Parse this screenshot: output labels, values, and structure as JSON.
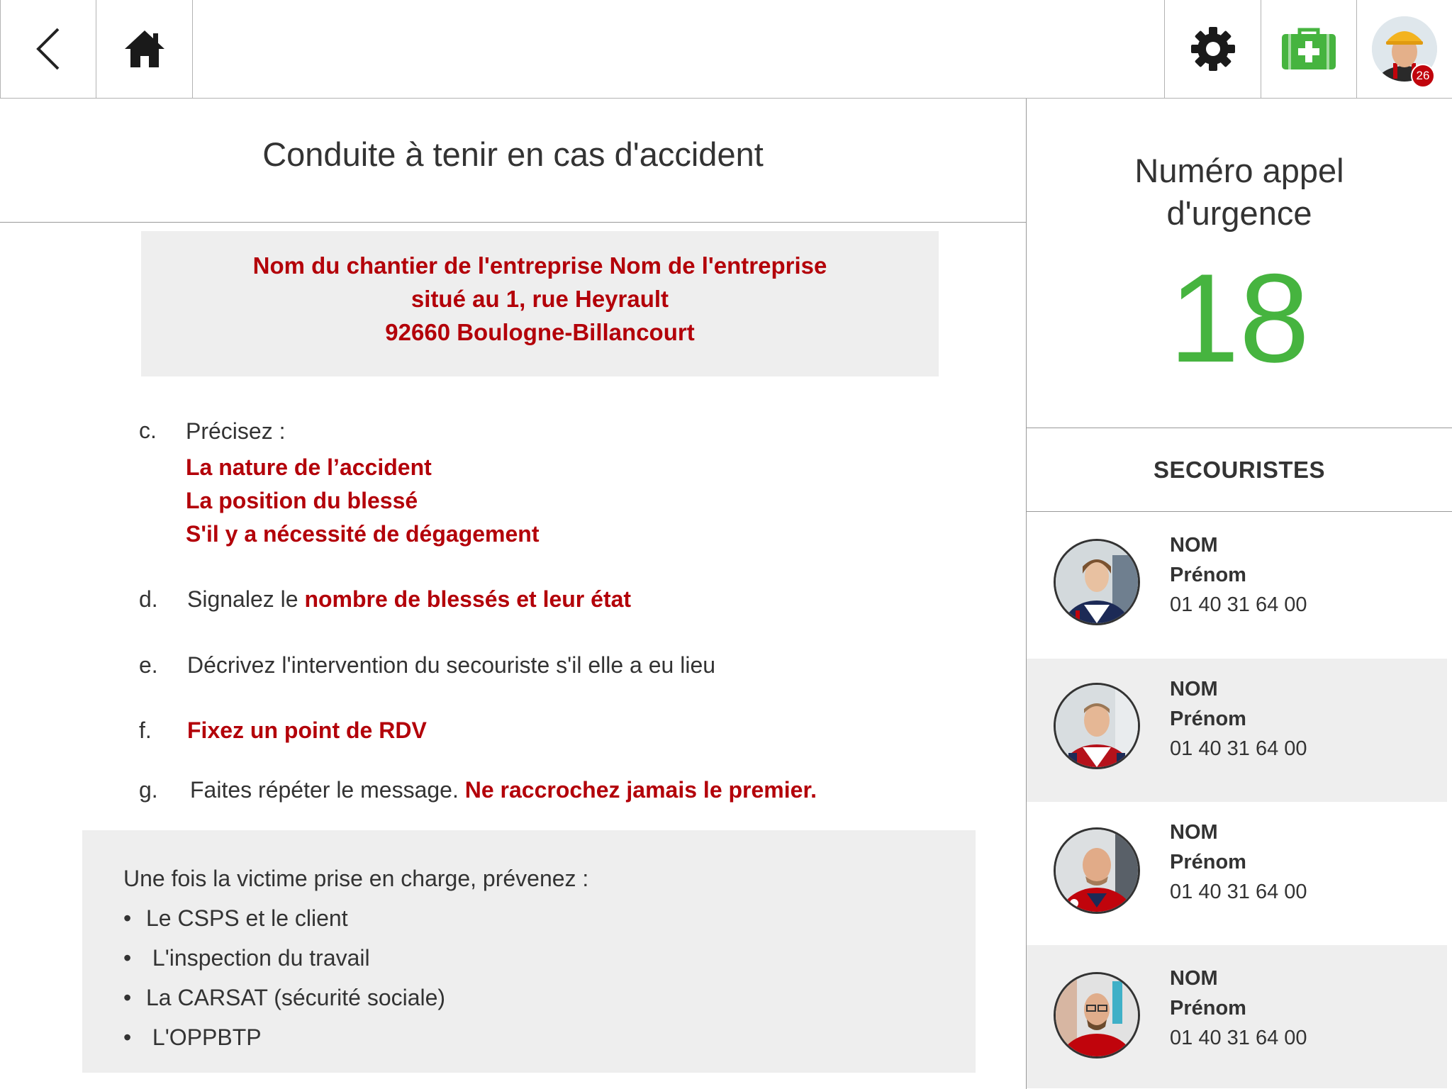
{
  "topbar": {
    "back_icon": "chevron-left-icon",
    "home_icon": "home-icon",
    "settings_icon": "gear-icon",
    "medkit_icon": "first-aid-kit-icon",
    "notification_count": "26",
    "accent_color": "#46b43f",
    "badge_color": "#c0040c"
  },
  "main": {
    "title": "Conduite à tenir en cas d'accident",
    "site": {
      "line1": "Nom du chantier de l'entreprise Nom de l'entreprise",
      "line2": "situé au 1, rue Heyrault",
      "line3": "92660 Boulogne-Billancourt"
    },
    "steps": {
      "c": {
        "letter": "c.",
        "text": "Précisez :",
        "items": [
          "La nature de l’accident",
          "La position du blessé",
          "S'il y a nécessité de dégagement"
        ]
      },
      "d": {
        "letter": "d.",
        "text": "Signalez le ",
        "highlight": "nombre de blessés et leur état"
      },
      "e": {
        "letter": "e.",
        "text": "Décrivez l'intervention du secouriste s'il elle a eu lieu"
      },
      "f": {
        "letter": "f.",
        "highlight": "Fixez un point de RDV"
      },
      "g": {
        "letter": "g.",
        "text": " Faites répéter le message. ",
        "highlight": "Ne raccrochez jamais le premier."
      }
    },
    "notice": {
      "intro": "Une fois la victime prise en charge, prévenez :",
      "bullets": [
        "Le CSPS et le client",
        " L'inspection du travail",
        "La CARSAT (sécurité sociale)",
        " L'OPPBTP"
      ]
    },
    "highlight_color": "#b30009"
  },
  "side": {
    "emergency_label_line1": "Numéro appel",
    "emergency_label_line2": "d'urgence",
    "emergency_number": "18",
    "rescuers_heading": "SECOURISTES",
    "rescuers": [
      {
        "name": "NOM",
        "firstname": "Prénom",
        "phone": "01 40 31 64 00"
      },
      {
        "name": "NOM",
        "firstname": "Prénom",
        "phone": "01 40 31 64 00"
      },
      {
        "name": "NOM",
        "firstname": "Prénom",
        "phone": "01 40 31 64 00"
      },
      {
        "name": "NOM",
        "firstname": "Prénom",
        "phone": "01 40 31 64 00"
      }
    ]
  }
}
